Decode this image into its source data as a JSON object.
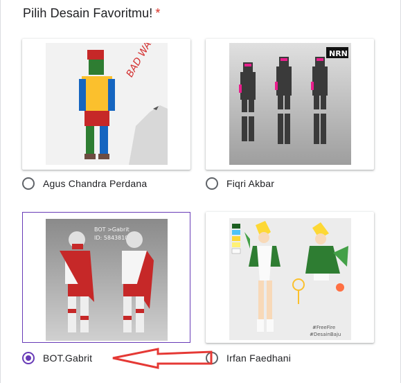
{
  "question": {
    "title": "Pilih Desain Favoritmu!",
    "required_marker": "*"
  },
  "options": [
    {
      "label": "Agus Chandra Perdana",
      "selected": false,
      "image": {
        "caption_art": "BAD WARRIOR",
        "background": "#f2f2f2",
        "accent": "#d32f2f"
      }
    },
    {
      "label": "Fiqri Akbar",
      "selected": false,
      "image": {
        "caption_art": "NRN",
        "background": "#cfcfcf",
        "accent": "#e91e8c"
      }
    },
    {
      "label": "BOT.Gabrit",
      "selected": true,
      "image": {
        "caption_art": "BOT >Gabrit ID: 584381068",
        "background": "#bdbdbd",
        "accent": "#c62828"
      }
    },
    {
      "label": "Irfan Faedhani",
      "selected": false,
      "image": {
        "caption_art": "#FreeFire #DesainBaju",
        "background": "#e6e6e6",
        "accent": "#4caf50"
      }
    }
  ],
  "annotation": {
    "arrow_color": "#e53935"
  }
}
